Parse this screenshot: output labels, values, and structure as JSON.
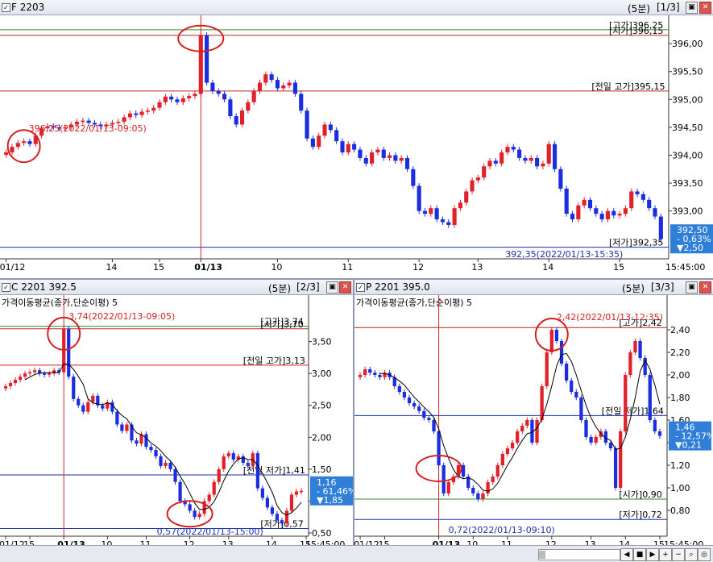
{
  "panels": [
    {
      "title": "F 2203",
      "period": "(5분)",
      "page": "[1/3]",
      "indicator": "",
      "ymin": 392.2,
      "ymax": 396.45,
      "yticks": [
        "396,00",
        "395,50",
        "395,00",
        "394,50",
        "394,00",
        "393,50",
        "393,00"
      ],
      "ytickvals": [
        396.0,
        395.5,
        395.0,
        394.5,
        394.0,
        393.5,
        393.0
      ],
      "xticks": [
        "01/12",
        "14",
        "15",
        "01/13",
        "10",
        "11",
        "12",
        "13",
        "14",
        "15"
      ],
      "time_label": "15:45:00",
      "h_lines": [
        {
          "label": "[고가]396,25",
          "value": 396.25,
          "color": "#2e8b2e"
        },
        {
          "label": "[시가]396,15",
          "value": 396.15,
          "color": "#cc2222"
        },
        {
          "label": "[전일 고가]395,15",
          "value": 395.15,
          "color": "#cc2222"
        },
        {
          "label": "[저가]392,35",
          "value": 392.35,
          "color": "#1e2fb0"
        }
      ],
      "high_annot": "396,25(2022/01/13-09:05)",
      "low_annot": "392,35(2022/01/13-15:35)",
      "last_box": [
        "392,50",
        "- 0,63%",
        "▼2,50"
      ],
      "closes": [
        394.05,
        394.15,
        394.22,
        394.25,
        394.2,
        394.35,
        394.48,
        394.52,
        394.5,
        394.48,
        394.5,
        394.55,
        394.6,
        394.62,
        394.58,
        394.55,
        394.52,
        394.55,
        394.58,
        394.6,
        394.68,
        394.75,
        394.72,
        394.78,
        394.8,
        394.85,
        394.95,
        395.05,
        395.0,
        394.95,
        395.02,
        395.06,
        395.1,
        396.15,
        395.3,
        395.15,
        395.1,
        395.0,
        394.7,
        394.55,
        394.8,
        394.95,
        395.15,
        395.3,
        395.45,
        395.35,
        395.2,
        395.25,
        395.3,
        395.1,
        394.8,
        394.3,
        394.15,
        394.35,
        394.55,
        394.45,
        394.25,
        394.05,
        394.2,
        394.1,
        393.95,
        393.85,
        394.05,
        394.1,
        393.95,
        394.0,
        393.9,
        393.95,
        393.75,
        393.45,
        393.0,
        392.95,
        393.05,
        392.85,
        392.8,
        392.75,
        393.05,
        393.15,
        393.35,
        393.55,
        393.6,
        393.8,
        393.9,
        393.85,
        394.05,
        394.15,
        394.1,
        393.95,
        393.9,
        393.95,
        393.8,
        393.85,
        394.2,
        393.75,
        393.4,
        392.95,
        392.85,
        393.1,
        393.2,
        393.05,
        392.95,
        392.85,
        393.0,
        392.92,
        392.95,
        393.05,
        393.35,
        393.3,
        393.2,
        393.05,
        392.9,
        392.5
      ],
      "marks": [
        3,
        33,
        75
      ],
      "ticks_idx": [
        0,
        18,
        26,
        33,
        46,
        58,
        70,
        80,
        92,
        104
      ]
    },
    {
      "title": "C 2201 392.5",
      "period": "(5분)",
      "page": "[2/3]",
      "indicator": "가격이동평균(종가,단순이평) 5",
      "ymin": 0.5,
      "ymax": 3.95,
      "yticks": [
        "3,50",
        "3,00",
        "2,50",
        "2,00",
        "1,50",
        "1,00",
        "0,50"
      ],
      "ytickvals": [
        3.5,
        3.0,
        2.5,
        2.0,
        1.5,
        1.0,
        0.5
      ],
      "xticks": [
        "01/12",
        "15",
        "01/13",
        "10",
        "11",
        "12",
        "13",
        "14",
        "15"
      ],
      "time_label": "15:45:00",
      "h_lines": [
        {
          "label": "[고가]3,74",
          "value": 3.74,
          "color": "#2e8b2e"
        },
        {
          "label": "[시가]3,70",
          "value": 3.7,
          "color": "#cc2222"
        },
        {
          "label": "[전일 고가]3,13",
          "value": 3.13,
          "color": "#cc2222"
        },
        {
          "label": "[전일 저가]1,41",
          "value": 1.41,
          "color": "#1e2fb0"
        },
        {
          "label": "[저가]0,57",
          "value": 0.57,
          "color": "#1e2fb0"
        }
      ],
      "high_annot": "3,74(2022/01/13-09:05)",
      "low_annot": "0,57(2022/01/13-15:00)",
      "last_box": [
        "1,16",
        "- 61,46%",
        "▼1,85"
      ],
      "closes": [
        2.8,
        2.85,
        2.9,
        2.95,
        3.0,
        3.02,
        3.05,
        3.0,
        2.98,
        3.0,
        3.05,
        3.02,
        3.7,
        2.95,
        2.6,
        2.5,
        2.4,
        2.55,
        2.65,
        2.5,
        2.45,
        2.55,
        2.4,
        2.2,
        2.1,
        2.2,
        1.95,
        1.9,
        2.05,
        1.85,
        1.8,
        1.7,
        1.55,
        1.6,
        1.5,
        1.3,
        1.0,
        0.95,
        0.85,
        0.75,
        0.8,
        1.0,
        1.1,
        1.3,
        1.5,
        1.7,
        1.75,
        1.65,
        1.7,
        1.6,
        1.55,
        1.75,
        1.2,
        1.05,
        0.9,
        0.8,
        0.7,
        0.65,
        0.85,
        1.1,
        1.15,
        1.16
      ],
      "marks": [
        12,
        38
      ],
      "ticks_idx": [
        0,
        5,
        12,
        21,
        29,
        38,
        46,
        55,
        62
      ]
    },
    {
      "title": "P 2201 395.0",
      "period": "(5분)",
      "page": "[3/3]",
      "indicator": "가격이동평균(종가,단순이평) 5",
      "ymin": 0.6,
      "ymax": 2.55,
      "yticks": [
        "2,40",
        "2,20",
        "2,00",
        "1,80",
        "1,60",
        "1,40",
        "1,20",
        "1,00",
        "0,80"
      ],
      "ytickvals": [
        2.4,
        2.2,
        2.0,
        1.8,
        1.6,
        1.4,
        1.2,
        1.0,
        0.8
      ],
      "xticks": [
        "01/12",
        "15",
        "01/13",
        "10",
        "11",
        "12",
        "13",
        "14",
        "15"
      ],
      "time_label": "15:45:00",
      "h_lines": [
        {
          "label": "[고가]2,42",
          "value": 2.42,
          "color": "#cc2222"
        },
        {
          "label": "[전일 저가]1,64",
          "value": 1.64,
          "color": "#1e2fb0"
        },
        {
          "label": "[시가]0,90",
          "value": 0.9,
          "color": "#2e8b2e"
        },
        {
          "label": "[저가]0,72",
          "value": 0.72,
          "color": "#1e2fb0"
        }
      ],
      "high_annot": "2,42(2022/01/13-12:35)",
      "low_annot": "0,72(2022/01/13-09:10)",
      "last_box": [
        "1,46",
        "- 12,57%",
        "▼0,21"
      ],
      "closes": [
        2.0,
        2.05,
        2.02,
        2.0,
        1.98,
        2.02,
        1.98,
        1.9,
        1.85,
        1.8,
        1.75,
        1.72,
        1.68,
        1.62,
        1.6,
        1.5,
        1.2,
        0.95,
        1.05,
        1.1,
        1.2,
        1.1,
        1.0,
        0.95,
        0.9,
        0.95,
        1.05,
        1.1,
        1.2,
        1.3,
        1.35,
        1.4,
        1.5,
        1.55,
        1.6,
        1.4,
        1.6,
        1.9,
        2.2,
        2.4,
        2.3,
        2.1,
        1.95,
        1.85,
        1.8,
        1.6,
        1.45,
        1.4,
        1.45,
        1.5,
        1.4,
        1.35,
        1.0,
        1.5,
        2.0,
        2.2,
        2.3,
        2.15,
        2.0,
        1.6,
        1.5,
        1.46
      ],
      "marks": [
        39,
        16
      ],
      "ticks_idx": [
        0,
        5,
        16,
        23,
        30,
        39,
        47,
        54,
        61
      ]
    }
  ],
  "bottom_icons": [
    "scroll-left-icon",
    "scroll-right-icon",
    "stop-icon",
    "next-icon",
    "zoom-in-icon",
    "zoom-out-icon",
    "search-icon",
    "zoom-icon"
  ]
}
